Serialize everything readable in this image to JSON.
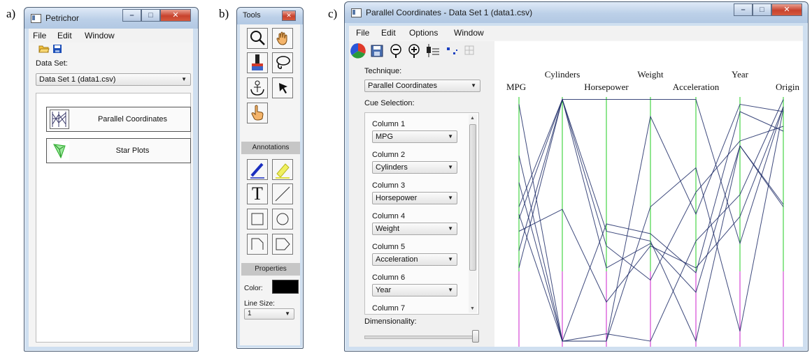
{
  "panel_labels": [
    "a)",
    "b)",
    "c)"
  ],
  "colors": {
    "axis_green": "#22cc22",
    "axis_magenta": "#cc22cc",
    "line_navy": "#1c2a66",
    "annotation_color": "#000000"
  },
  "petrichor": {
    "title": "Petrichor",
    "menu": [
      "File",
      "Edit",
      "Window"
    ],
    "toolbar_icons": [
      "open-folder-icon",
      "save-disk-icon"
    ],
    "dataset_label": "Data Set:",
    "dataset_value": "Data Set 1 (data1.csv)",
    "techniques": [
      {
        "label": "Parallel Coordinates",
        "icon": "parallel-coordinates-icon"
      },
      {
        "label": "Star Plots",
        "icon": "star-plot-icon"
      }
    ]
  },
  "tools": {
    "title": "Tools",
    "tool_icons": [
      "magnifier-icon",
      "hand-pan-icon",
      "brush-icon",
      "lasso-icon",
      "anchor-icon",
      "arrow-pointer-icon",
      "pointer-hand-icon"
    ],
    "annotations_header": "Annotations",
    "annotation_icons": [
      "pen-icon",
      "highlighter-icon",
      "text-icon",
      "line-icon",
      "rectangle-icon",
      "circle-icon",
      "corner-icon",
      "tag-shape-icon"
    ],
    "text_tool_glyph": "T",
    "properties_header": "Properties",
    "color_label": "Color:",
    "line_size_label": "Line Size:",
    "line_size_value": "1"
  },
  "pc_window": {
    "title": "Parallel Coordinates - Data Set 1 (data1.csv)",
    "menu": [
      "File",
      "Edit",
      "Options",
      "Window"
    ],
    "toolbar_icons": [
      "color-wheel-icon",
      "save-disk-icon",
      "filter-icon",
      "add-filter-icon",
      "axis-adjust-icon",
      "scatter-points-icon",
      "grid-icon"
    ],
    "technique_label": "Technique:",
    "technique_value": "Parallel Coordinates",
    "cue_label": "Cue Selection:",
    "columns": [
      {
        "label": "Column 1",
        "value": "MPG"
      },
      {
        "label": "Column 2",
        "value": "Cylinders"
      },
      {
        "label": "Column 3",
        "value": "Horsepower"
      },
      {
        "label": "Column 4",
        "value": "Weight"
      },
      {
        "label": "Column 5",
        "value": "Acceleration"
      },
      {
        "label": "Column 6",
        "value": "Year"
      },
      {
        "label": "Column 7",
        "value": ""
      }
    ],
    "dimensionality_label": "Dimensionality:",
    "dimensionality_level": 1.0
  },
  "chart_data": {
    "type": "parallel-coordinates",
    "axes": [
      "MPG",
      "Cylinders",
      "Horsepower",
      "Weight",
      "Acceleration",
      "Year",
      "Origin"
    ],
    "value_scale": "normalized 0 (bottom) to 1 (top) per axis",
    "records": [
      [
        0.97,
        0.0,
        0.0,
        0.92,
        0.52,
        0.97,
        0.94
      ],
      [
        0.55,
        0.99,
        0.45,
        0.41,
        0.0,
        0.8,
        0.56
      ],
      [
        0.45,
        0.54,
        0.16,
        0.39,
        0.3,
        0.51,
        0.96
      ],
      [
        0.37,
        0.99,
        0.99,
        0.99,
        0.99,
        0.4,
        0.96
      ],
      [
        0.5,
        0.99,
        0.3,
        0.4,
        0.2,
        0.8,
        0.55
      ],
      [
        0.65,
        0.0,
        0.03,
        0.0,
        0.41,
        0.6,
        0.99
      ],
      [
        0.52,
        0.0,
        0.0,
        0.55,
        0.71,
        0.04,
        0.95
      ],
      [
        0.76,
        0.0,
        0.48,
        0.44,
        0.28,
        0.94,
        0.86
      ],
      [
        0.3,
        0.99,
        0.39,
        0.25,
        0.61,
        0.82,
        0.88
      ]
    ]
  }
}
